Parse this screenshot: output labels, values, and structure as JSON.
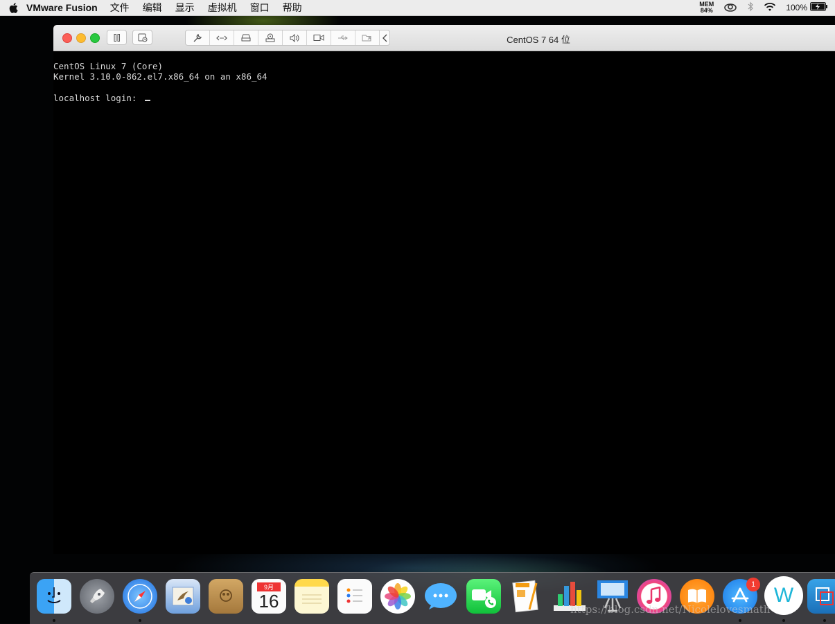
{
  "menubar": {
    "app_name": "VMware Fusion",
    "menus": [
      "文件",
      "编辑",
      "显示",
      "虚拟机",
      "窗口",
      "帮助"
    ],
    "mem_label": "MEM",
    "mem_value": "84%",
    "battery": "100%"
  },
  "window": {
    "title": "CentOS 7 64 位"
  },
  "console": {
    "line1": "CentOS Linux 7 (Core)",
    "line2": "Kernel 3.10.0-862.el7.x86_64 on an x86_64",
    "prompt": "localhost login: "
  },
  "dock": {
    "calendar_month": "9月",
    "calendar_day": "16",
    "app_store_badge": "1",
    "wechat_letter": "W"
  },
  "watermark": "https://blog.csdn.net/Nicolelovesmath",
  "colors": {
    "close": "#fc5f57",
    "minimize": "#fdbc2e",
    "maximize": "#28c840",
    "console_bg": "#000000",
    "console_text": "#d8d8d8"
  }
}
